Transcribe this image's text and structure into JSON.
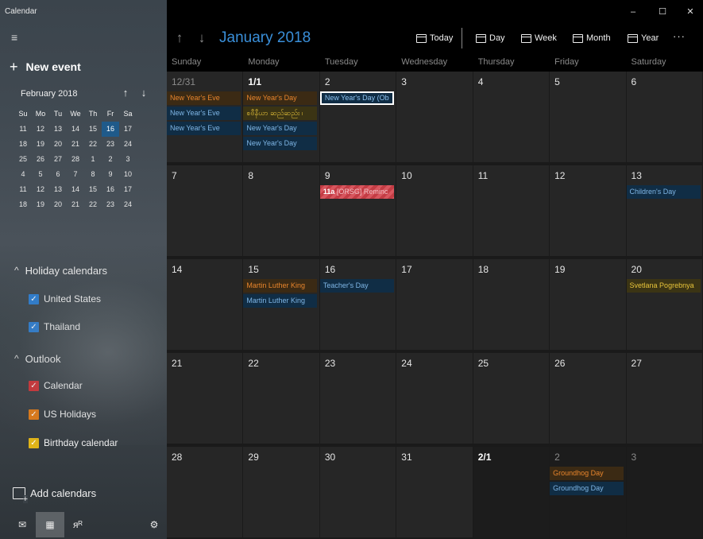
{
  "window": {
    "title": "Calendar",
    "minimize": "–",
    "maximize": "☐",
    "close": "✕"
  },
  "sidebar": {
    "menu_icon": "≡",
    "new_event_plus": "+",
    "new_event_label": "New event",
    "mini_calendar": {
      "title": "February 2018",
      "prev_arrow": "↑",
      "next_arrow": "↓",
      "headers": [
        "Su",
        "Mo",
        "Tu",
        "We",
        "Th",
        "Fr",
        "Sa"
      ],
      "weeks": [
        [
          "11",
          "12",
          "13",
          "14",
          "15",
          "16",
          "17"
        ],
        [
          "18",
          "19",
          "20",
          "21",
          "22",
          "23",
          "24"
        ],
        [
          "25",
          "26",
          "27",
          "28",
          "1",
          "2",
          "3"
        ],
        [
          "4",
          "5",
          "6",
          "7",
          "8",
          "9",
          "10"
        ],
        [
          "11",
          "12",
          "13",
          "14",
          "15",
          "16",
          "17"
        ],
        [
          "18",
          "19",
          "20",
          "21",
          "22",
          "23",
          "24"
        ]
      ],
      "selected": "16"
    },
    "holiday_header": "Holiday calendars",
    "holiday_chevron": "^",
    "holiday_calendars": [
      {
        "label": "United States",
        "color": "#2d7fd3"
      },
      {
        "label": "Thailand",
        "color": "#2d7fd3"
      }
    ],
    "outlook_header": "Outlook",
    "outlook_chevron": "^",
    "outlook_calendars": [
      {
        "label": "Calendar",
        "color": "#d13438"
      },
      {
        "label": "US Holidays",
        "color": "#e07b18"
      },
      {
        "label": "Birthday calendar",
        "color": "#e0b418"
      }
    ],
    "check_mark": "✓",
    "add_calendars": "Add calendars",
    "bottom_icons": [
      "✉",
      "▦",
      "ᴙᴿ",
      "⚙"
    ]
  },
  "toolbar": {
    "up_arrow": "↑",
    "down_arrow": "↓",
    "month_title": "January 2018",
    "today": "Today",
    "day": "Day",
    "week": "Week",
    "month": "Month",
    "year": "Year",
    "more": "···"
  },
  "days_of_week": [
    "Sunday",
    "Monday",
    "Tuesday",
    "Wednesday",
    "Thursday",
    "Friday",
    "Saturday"
  ],
  "weeks": [
    {
      "days": [
        {
          "num": "12/31",
          "style": "muted",
          "events": [
            {
              "text": "New Year's Eve",
              "kind": "orange"
            },
            {
              "text": "New Year's Eve",
              "kind": "blue"
            },
            {
              "text": "New Year's Eve",
              "kind": "blue"
            }
          ]
        },
        {
          "num": "1/1",
          "style": "bold",
          "events": [
            {
              "text": "New Year's Day",
              "kind": "orange"
            },
            {
              "text": "စဗီနီယာ ဆည်ဆည်း ၊",
              "kind": "olive"
            },
            {
              "text": "New Year's Day",
              "kind": "blue"
            },
            {
              "text": "New Year's Day",
              "kind": "blue"
            }
          ]
        },
        {
          "num": "2",
          "style": "",
          "events": [
            {
              "text": "New Year's Day (Ob",
              "kind": "sel"
            }
          ]
        },
        {
          "num": "3",
          "style": "",
          "events": []
        },
        {
          "num": "4",
          "style": "",
          "events": []
        },
        {
          "num": "5",
          "style": "",
          "events": []
        },
        {
          "num": "6",
          "style": "",
          "events": []
        }
      ]
    },
    {
      "days": [
        {
          "num": "7",
          "style": "",
          "events": []
        },
        {
          "num": "8",
          "style": "",
          "events": []
        },
        {
          "num": "9",
          "style": "",
          "events": [
            {
              "text": "[ORSG] Reminc",
              "time": "11a",
              "kind": "reminder"
            }
          ]
        },
        {
          "num": "10",
          "style": "",
          "events": []
        },
        {
          "num": "11",
          "style": "",
          "events": []
        },
        {
          "num": "12",
          "style": "",
          "events": []
        },
        {
          "num": "13",
          "style": "",
          "events": [
            {
              "text": "Children's Day",
              "kind": "blue"
            }
          ]
        }
      ]
    },
    {
      "days": [
        {
          "num": "14",
          "style": "",
          "events": []
        },
        {
          "num": "15",
          "style": "",
          "events": [
            {
              "text": "Martin Luther King",
              "kind": "orange"
            },
            {
              "text": "Martin Luther King",
              "kind": "blue"
            }
          ]
        },
        {
          "num": "16",
          "style": "",
          "events": [
            {
              "text": "Teacher's Day",
              "kind": "blue"
            }
          ]
        },
        {
          "num": "17",
          "style": "",
          "events": []
        },
        {
          "num": "18",
          "style": "",
          "events": []
        },
        {
          "num": "19",
          "style": "",
          "events": []
        },
        {
          "num": "20",
          "style": "",
          "events": [
            {
              "text": "Svetlana Pogrebnya",
              "kind": "olive"
            }
          ]
        }
      ]
    },
    {
      "days": [
        {
          "num": "21",
          "style": "",
          "events": []
        },
        {
          "num": "22",
          "style": "",
          "events": []
        },
        {
          "num": "23",
          "style": "",
          "events": []
        },
        {
          "num": "24",
          "style": "",
          "events": []
        },
        {
          "num": "25",
          "style": "",
          "events": []
        },
        {
          "num": "26",
          "style": "",
          "events": []
        },
        {
          "num": "27",
          "style": "",
          "events": []
        }
      ]
    },
    {
      "days": [
        {
          "num": "28",
          "style": "",
          "events": []
        },
        {
          "num": "29",
          "style": "",
          "events": []
        },
        {
          "num": "30",
          "style": "",
          "events": []
        },
        {
          "num": "31",
          "style": "",
          "events": []
        },
        {
          "num": "2/1",
          "style": "bold-next",
          "events": []
        },
        {
          "num": "2",
          "style": "muted-next",
          "events": [
            {
              "text": "Groundhog Day",
              "kind": "orange"
            },
            {
              "text": "Groundhog Day",
              "kind": "blue"
            }
          ]
        },
        {
          "num": "3",
          "style": "muted-next",
          "events": []
        }
      ]
    }
  ]
}
